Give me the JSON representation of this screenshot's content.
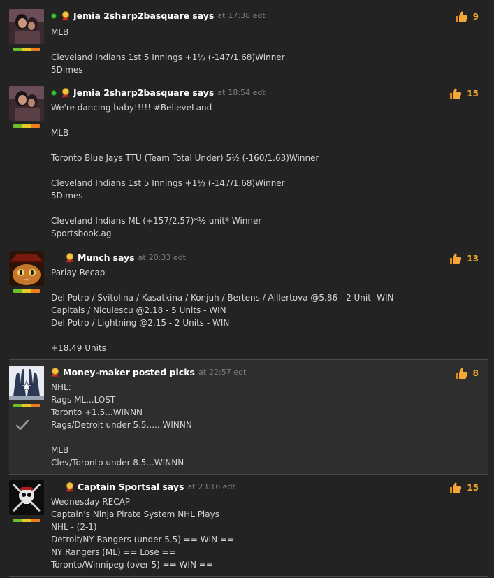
{
  "posts": [
    {
      "author": "Jemia 2sharp2basquare",
      "verb": "says",
      "at": "at",
      "time": "17:38 edt",
      "online": true,
      "likes": "9",
      "avatar": "woman-portrait-avatar",
      "lines": [
        "MLB",
        "",
        "Cleveland Indians 1st 5 Innings +1½ (-147/1.68)Winner",
        "5Dimes"
      ]
    },
    {
      "author": "Jemia 2sharp2basquare",
      "verb": "says",
      "at": "at",
      "time": "18:54 edt",
      "online": true,
      "likes": "15",
      "avatar": "woman-portrait-avatar",
      "lines": [
        "We're dancing baby!!!!! #BelieveLand",
        "",
        "MLB",
        "",
        "Toronto Blue Jays TTU (Team Total Under) 5½ (-160/1.63)Winner",
        "",
        "Cleveland Indians 1st 5 Innings +1½ (-147/1.68)Winner",
        "5Dimes",
        "",
        "Cleveland Indians ML (+157/2.57)*½ unit* Winner",
        "Sportsbook.ag"
      ]
    },
    {
      "author": "Munch",
      "verb": "says",
      "at": "at",
      "time": "20:33 edt",
      "online": false,
      "likes": "13",
      "avatar": "cat-in-hat-avatar",
      "lines": [
        "Parlay Recap",
        "",
        "Del Potro / Svitolina / Kasatkina / Konjuh / Bertens / Alllertova @5.86 - 2 Unit- WIN",
        "Capitals / Niculescu @2.18 - 5 Units - WIN",
        "Del Potro / Lightning @2.15 - 2 Units - WIN",
        "",
        "+18.49 Units"
      ]
    },
    {
      "author": "Money-maker",
      "verb": "posted picks",
      "at": "at",
      "time": "22:57 edt",
      "online": false,
      "likes": "8",
      "avatar": "cowboys-gloves-avatar",
      "lines": [
        "NHL:",
        "Rags ML...LOST",
        "Toronto +1.5...WINNN",
        "Rags/Detroit under 5.5......WINNN",
        "",
        "MLB",
        "Clev/Toronto under 8.5...WINNN"
      ]
    },
    {
      "author": "Captain Sportsal",
      "verb": "says",
      "at": "at",
      "time": "23:16 edt",
      "online": false,
      "likes": "15",
      "avatar": "pirate-skull-avatar",
      "lines": [
        "Wednesday RECAP",
        "Captain's Ninja Pirate System NHL Plays",
        "NHL - (2-1)",
        "Detroit/NY Rangers (under 5.5) == WIN ==",
        "NY Rangers (ML) == Lose ==",
        "Toronto/Winnipeg (over 5) == WIN =="
      ]
    }
  ],
  "colors": {
    "background": "#232323",
    "highlight": "#2e2e2e",
    "like_count": "#f0a52b",
    "online": "#39c534"
  },
  "icons": {
    "online": "online-dot-icon",
    "badge": "award-ribbon-icon",
    "like": "thumbs-up-icon",
    "check": "checkmark-icon"
  }
}
